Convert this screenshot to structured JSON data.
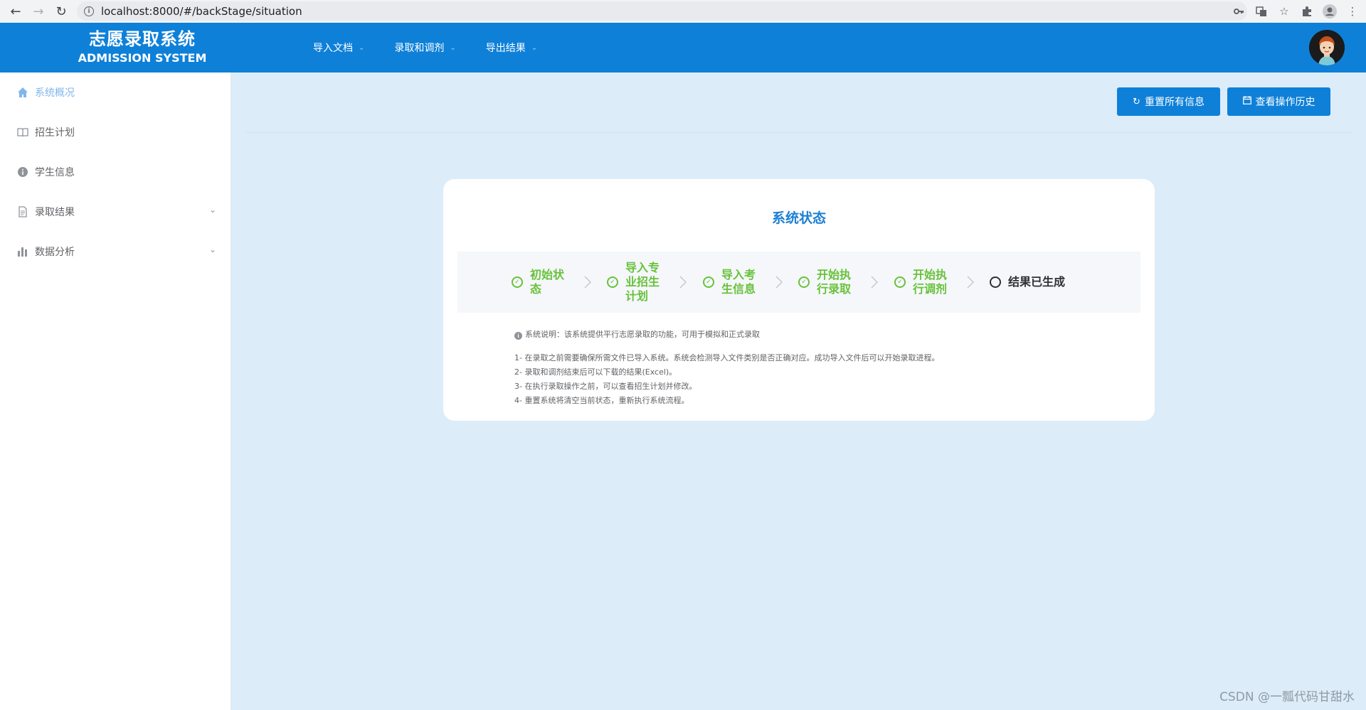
{
  "browser": {
    "url": "localhost:8000/#/backStage/situation",
    "icons": [
      "back-arrow-icon",
      "forward-arrow-icon",
      "reload-icon",
      "info-icon",
      "key-icon",
      "translate-icon",
      "star-icon",
      "extension-icon",
      "profile-icon",
      "kebab-menu-icon"
    ]
  },
  "header": {
    "title_cn": "志愿录取系统",
    "title_en": "ADMISSION SYSTEM",
    "menu": [
      {
        "label": "导入文档"
      },
      {
        "label": "录取和调剂"
      },
      {
        "label": "导出结果"
      }
    ],
    "bg_color": "#0e80d8"
  },
  "sidebar": {
    "items": [
      {
        "label": "系统概况",
        "icon": "home-icon",
        "active": true
      },
      {
        "label": "招生计划",
        "icon": "book-icon"
      },
      {
        "label": "学生信息",
        "icon": "info-circle-icon"
      },
      {
        "label": "录取结果",
        "icon": "document-icon",
        "expandable": true
      },
      {
        "label": "数据分析",
        "icon": "bar-chart-icon",
        "expandable": true
      }
    ]
  },
  "actions": {
    "reset_label": "重置所有信息",
    "history_label": "查看操作历史"
  },
  "status_card": {
    "title": "系统状态",
    "steps": [
      {
        "label": "初始状态",
        "done": true
      },
      {
        "label": "导入专业招生计划",
        "done": true
      },
      {
        "label": "导入考生信息",
        "done": true
      },
      {
        "label": "开始执行录取",
        "done": true
      },
      {
        "label": "开始执行调剂",
        "done": true
      },
      {
        "label": "结果已生成",
        "done": false
      }
    ],
    "description": "系统说明：该系统提供平行志愿录取的功能，可用于模拟和正式录取",
    "notes": [
      "1- 在录取之前需要确保所需文件已导入系统。系统会检测导入文件类别是否正确对应。成功导入文件后可以开始录取进程。",
      "2- 录取和调剂结束后可以下载的结果(Excel)。",
      "3- 在执行录取操作之前，可以查看招生计划并修改。",
      "4- 重置系统将清空当前状态，重新执行系统流程。"
    ]
  },
  "watermark": "CSDN @一瓢代码甘甜水"
}
